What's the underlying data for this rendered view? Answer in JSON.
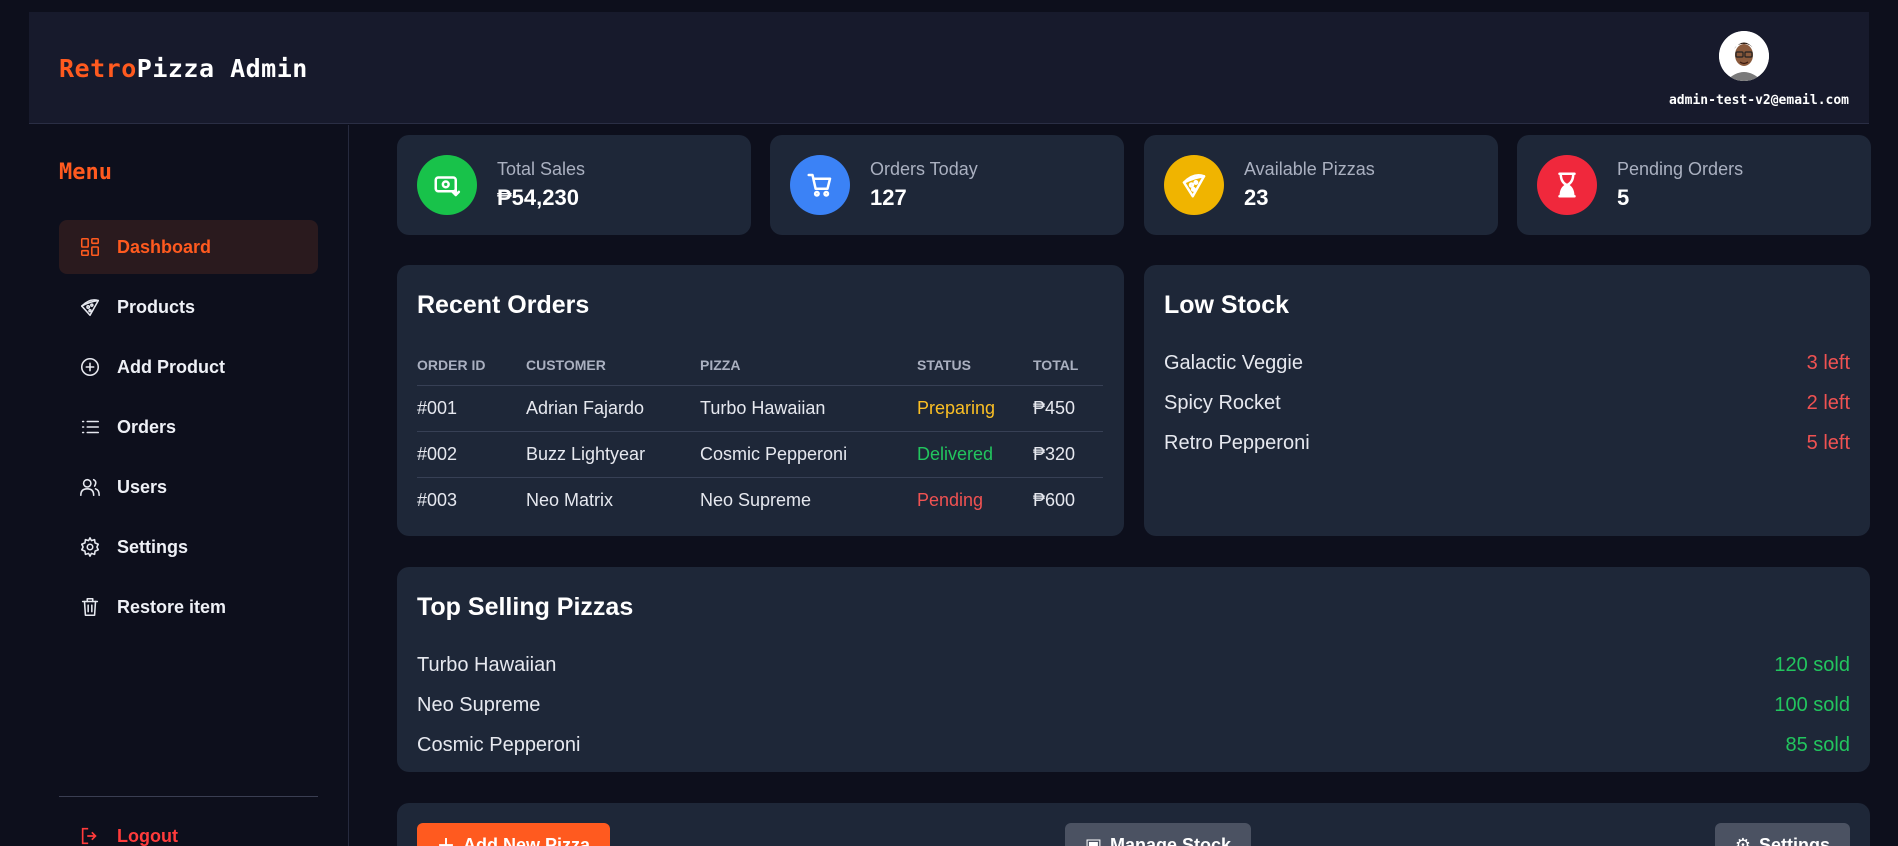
{
  "header": {
    "brand_accent": "Retro",
    "brand_rest": "Pizza Admin",
    "user_email": "admin-test-v2@email.com"
  },
  "sidebar": {
    "menu_title": "Menu",
    "items": [
      {
        "label": "Dashboard",
        "icon": "dashboard-icon",
        "active": true
      },
      {
        "label": "Products",
        "icon": "pizza-icon",
        "active": false
      },
      {
        "label": "Add Product",
        "icon": "plus-circle-icon",
        "active": false
      },
      {
        "label": "Orders",
        "icon": "list-icon",
        "active": false
      },
      {
        "label": "Users",
        "icon": "users-icon",
        "active": false
      },
      {
        "label": "Settings",
        "icon": "gear-icon",
        "active": false
      },
      {
        "label": "Restore item",
        "icon": "trash-icon",
        "active": false
      }
    ],
    "logout_label": "Logout"
  },
  "stats": [
    {
      "label": "Total Sales",
      "value": "₱54,230",
      "icon": "money-icon",
      "color": "#22c55e"
    },
    {
      "label": "Orders Today",
      "value": "127",
      "icon": "cart-icon",
      "color": "#3b82f6"
    },
    {
      "label": "Available Pizzas",
      "value": "23",
      "icon": "pizza-icon",
      "color": "#f0b400"
    },
    {
      "label": "Pending Orders",
      "value": "5",
      "icon": "hourglass-icon",
      "color": "#f0283c"
    }
  ],
  "recent_orders": {
    "title": "Recent Orders",
    "columns": [
      "ORDER ID",
      "CUSTOMER",
      "PIZZA",
      "STATUS",
      "TOTAL"
    ],
    "rows": [
      {
        "id": "#001",
        "customer": "Adrian Fajardo",
        "pizza": "Turbo Hawaiian",
        "status": "Preparing",
        "total": "₱450"
      },
      {
        "id": "#002",
        "customer": "Buzz Lightyear",
        "pizza": "Cosmic Pepperoni",
        "status": "Delivered",
        "total": "₱320"
      },
      {
        "id": "#003",
        "customer": "Neo Matrix",
        "pizza": "Neo Supreme",
        "status": "Pending",
        "total": "₱600"
      }
    ]
  },
  "low_stock": {
    "title": "Low Stock",
    "items": [
      {
        "name": "Galactic Veggie",
        "left": "3 left"
      },
      {
        "name": "Spicy Rocket",
        "left": "2 left"
      },
      {
        "name": "Retro Pepperoni",
        "left": "5 left"
      }
    ]
  },
  "top_selling": {
    "title": "Top Selling Pizzas",
    "items": [
      {
        "name": "Turbo Hawaiian",
        "sold": "120 sold"
      },
      {
        "name": "Neo Supreme",
        "sold": "100 sold"
      },
      {
        "name": "Cosmic Pepperoni",
        "sold": "85 sold"
      }
    ]
  },
  "actions": {
    "add_pizza": "Add New Pizza",
    "manage_stock": "Manage Stock",
    "settings": "Settings"
  },
  "colors": {
    "accent": "#ff5a1f",
    "add_pizza_button": "#ff5a1f",
    "secondary_button": "#4b5262"
  }
}
